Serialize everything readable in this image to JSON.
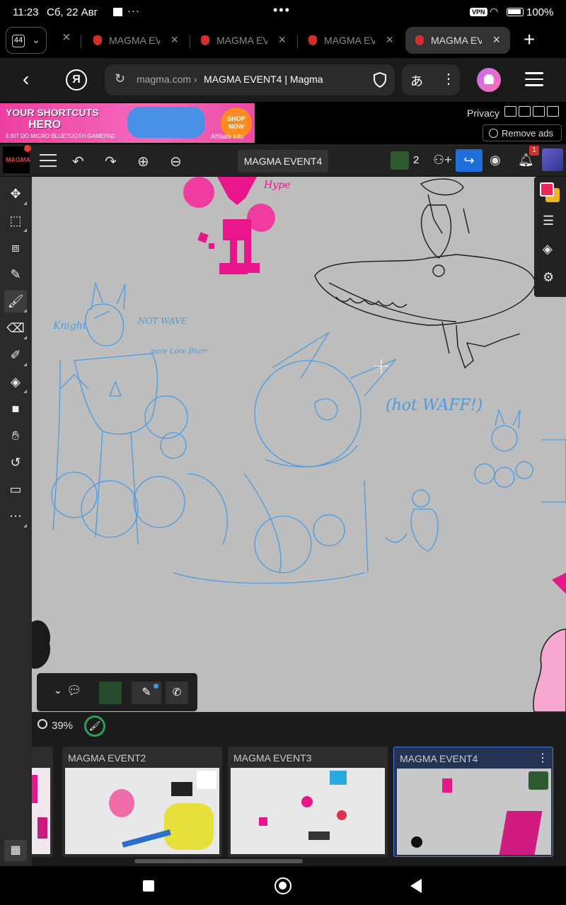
{
  "status": {
    "time": "11:23",
    "date": "Сб, 22 Авг",
    "overflow": "···",
    "vpn": "VPN",
    "battery": "100%"
  },
  "tabs": {
    "count": "44",
    "items": [
      {
        "label": "MAGMA EV",
        "active": false
      },
      {
        "label": "MAGMA EV",
        "active": false
      },
      {
        "label": "MAGMA EV",
        "active": false
      },
      {
        "label": "MAGMA EV",
        "active": true
      }
    ],
    "new_tab": "+"
  },
  "address": {
    "domain": "magma.com",
    "separator": "›",
    "title": "MAGMA EVENT4 | Magma",
    "translate": "あ"
  },
  "ad": {
    "line1": "YOUR SHORTCUTS",
    "line2": "HERO",
    "line3": "8 BIT DO MICRO BLUETOOTH GAMEPAD",
    "shop": "SHOP NOW",
    "affiliate": "Affiliate info",
    "privacy": "Privacy",
    "remove_ads": "Remove ads"
  },
  "magma_toolbar": {
    "logo": "MAGMA",
    "document_name": "MAGMA EVENT4",
    "user_count": "2",
    "notifications": "1"
  },
  "canvas": {
    "texts": {
      "hype": "Hype",
      "knight": "Knight",
      "not_wave": "NOT WAVE",
      "pure_lore": "pure Lore Blurr",
      "hot_waff": "(hot WAFF!)"
    },
    "colors": {
      "background": "#bdbdbd",
      "pink": "#e0207f",
      "blue": "#4a9be0",
      "black": "#1a1a1a"
    }
  },
  "primary_color": "#f0265a",
  "secondary_color": "#f0b428",
  "zoom": {
    "value": "39%"
  },
  "drawings": [
    {
      "name": "MAGMA EVENT2"
    },
    {
      "name": "MAGMA EVENT3"
    },
    {
      "name": "MAGMA EVENT4"
    }
  ]
}
